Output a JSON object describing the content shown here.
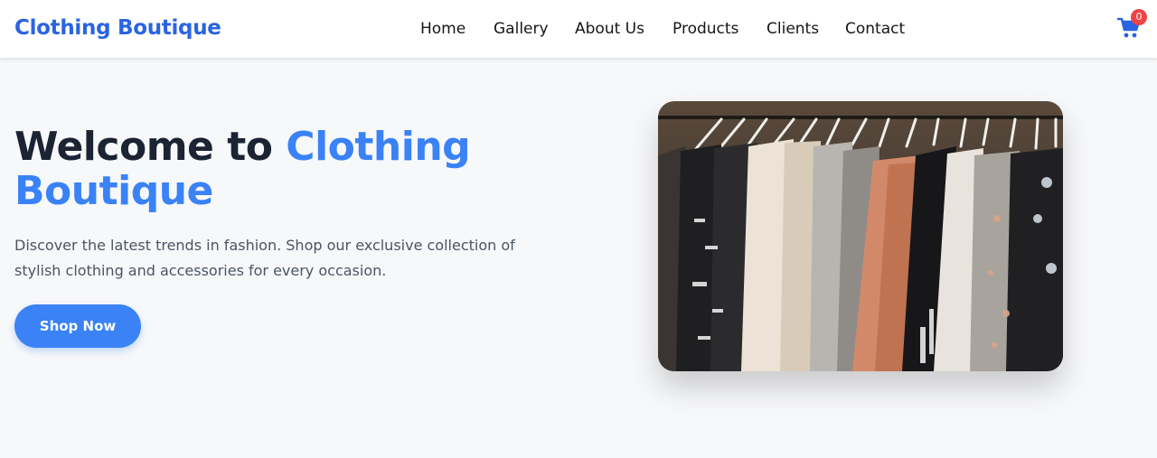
{
  "header": {
    "brand": "Clothing Boutique",
    "nav": [
      "Home",
      "Gallery",
      "About Us",
      "Products",
      "Clients",
      "Contact"
    ],
    "cart_count": "0",
    "cart_icon": "shopping-cart-icon"
  },
  "hero": {
    "title_prefix": "Welcome to ",
    "title_accent": "Clothing Boutique",
    "description": "Discover the latest trends in fashion. Shop our exclusive collection of stylish clothing and accessories for every occasion.",
    "cta_label": "Shop Now",
    "image_subject": "clothing rack"
  },
  "colors": {
    "brand": "#2a64e0",
    "accent": "#3a82f6",
    "heading": "#1c2333",
    "body_text": "#4b5563",
    "badge": "#ef4444",
    "page_bg": "#f7f8fa"
  }
}
